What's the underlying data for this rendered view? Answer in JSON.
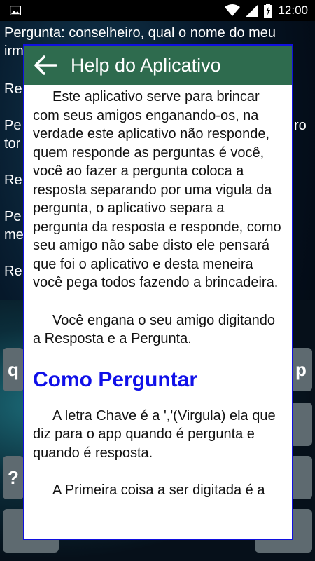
{
  "status_bar": {
    "time": "12:00",
    "icons": [
      "image-icon",
      "wifi-icon",
      "signal-icon",
      "battery-icon"
    ]
  },
  "background": {
    "lines": [
      "Pergunta: conselheiro, qual o nome do meu",
      "irm",
      "Re",
      "Pe",
      "ro",
      "tor",
      "Re",
      "Pe",
      "me",
      "Re"
    ],
    "keys": [
      "q",
      "p",
      "?",
      ","
    ]
  },
  "dialog": {
    "title": "Help do Aplicativo",
    "paragraph1": "Este aplicativo serve para  brincar com seus amigos enganando-os, na verdade este aplicativo não responde, quem responde as perguntas é você, você ao fazer a pergunta coloca a resposta separando por uma vigula da pergunta, o aplicativo separa a pergunta da resposta e responde, como seu amigo não sabe disto ele pensará que foi o aplicativo e desta meneira você pega todos fazendo a brincadeira.",
    "paragraph2": "Você engana o seu amigo digitando a Resposta e a Pergunta.",
    "section_heading": "Como Perguntar",
    "paragraph3": "A letra Chave é a ','(Virgula) ela que diz para o app quando é pergunta e quando é resposta.",
    "paragraph4": "A Primeira coisa a ser digitada é a"
  },
  "colors": {
    "header": "#2e6b4e",
    "dialog_border": "#1010e0",
    "heading": "#1010e8"
  }
}
